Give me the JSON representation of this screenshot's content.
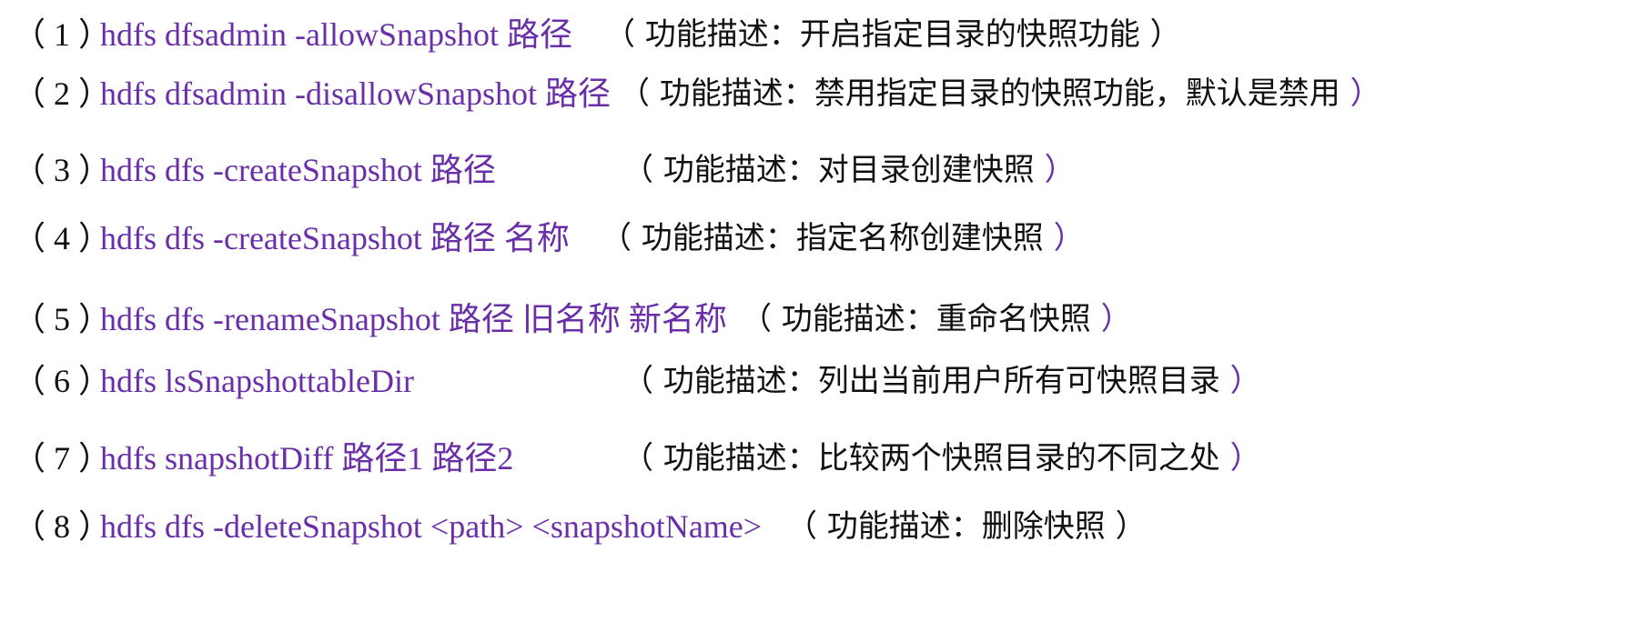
{
  "items": [
    {
      "num": "（ 1 ）",
      "cmd": "hdfs dfsadmin -allowSnapshot 路径",
      "desc": "（ 功能描述：开启指定目录的快照功能 ）",
      "close": ""
    },
    {
      "num": "（ 2 ）",
      "cmd": "hdfs dfsadmin -disallowSnapshot 路径",
      "desc": "（ 功能描述：禁用指定目录的快照功能，默认是禁用",
      "close": " ）"
    },
    {
      "num": "（ 3 ）",
      "cmd": "hdfs dfs -createSnapshot 路径",
      "desc": "（ 功能描述：对目录创建快照",
      "close": " ）"
    },
    {
      "num": "（ 4 ）",
      "cmd": "hdfs dfs -createSnapshot 路径 名称",
      "desc": "（ 功能描述：指定名称创建快照",
      "close": " ）"
    },
    {
      "num": "（ 5 ）",
      "cmd": "hdfs dfs -renameSnapshot 路径 旧名称 新名称",
      "desc": "（ 功能描述：重命名快照",
      "close": " ）"
    },
    {
      "num": "（ 6 ）",
      "cmd": "hdfs lsSnapshottableDir",
      "desc": "（ 功能描述：列出当前用户所有可快照目录",
      "close": " ）"
    },
    {
      "num": "（ 7 ）",
      "cmd": "hdfs snapshotDiff 路径1 路径2",
      "desc": "（ 功能描述：比较两个快照目录的不同之处",
      "close": " ）"
    },
    {
      "num": "（ 8 ）",
      "cmd": "hdfs dfs -deleteSnapshot <path> <snapshotName>",
      "desc": "（ 功能描述：删除快照 ）",
      "close": ""
    }
  ],
  "colors": {
    "command": "#6a2fa8",
    "text": "#111111",
    "background": "#ffffff"
  }
}
